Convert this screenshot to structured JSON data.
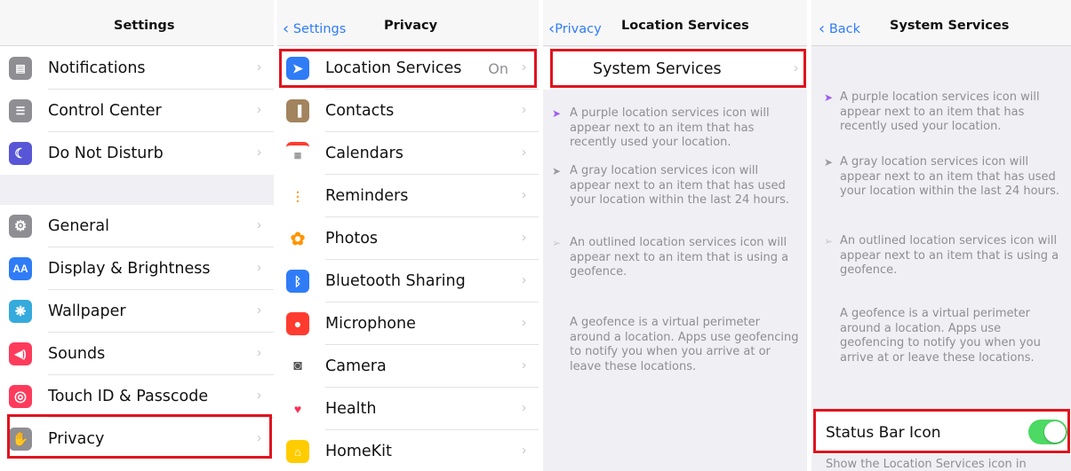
{
  "settings_panel": {
    "title": "Settings",
    "group1": [
      {
        "label": "Notifications",
        "icon": "notifications-icon",
        "color": "#8e8e93"
      },
      {
        "label": "Control Center",
        "icon": "control-center-icon",
        "color": "#8e8e93"
      },
      {
        "label": "Do Not Disturb",
        "icon": "moon-icon",
        "color": "#5856d6"
      }
    ],
    "group2": [
      {
        "label": "General",
        "icon": "gear-icon",
        "color": "#8e8e93"
      },
      {
        "label": "Display & Brightness",
        "icon": "display-brightness-icon",
        "color": "#2f7cf6",
        "glyph": "AA"
      },
      {
        "label": "Wallpaper",
        "icon": "wallpaper-icon",
        "color": "#35aadc"
      },
      {
        "label": "Sounds",
        "icon": "speaker-icon",
        "color": "#ff3b5c"
      },
      {
        "label": "Touch ID & Passcode",
        "icon": "fingerprint-icon",
        "color": "#ff3b5c"
      },
      {
        "label": "Privacy",
        "icon": "hand-icon",
        "color": "#8e8e93"
      }
    ]
  },
  "privacy_panel": {
    "back_label": "Settings",
    "title": "Privacy",
    "items": [
      {
        "label": "Location Services",
        "value": "On",
        "icon": "location-arrow-icon",
        "color": "#2f7cf6"
      },
      {
        "label": "Contacts",
        "icon": "contacts-icon",
        "color": "#a2845e"
      },
      {
        "label": "Calendars",
        "icon": "calendar-icon",
        "color": "#ffffff"
      },
      {
        "label": "Reminders",
        "icon": "reminders-icon",
        "color": "#ffffff"
      },
      {
        "label": "Photos",
        "icon": "photos-icon",
        "color": "#ff9500"
      },
      {
        "label": "Bluetooth Sharing",
        "icon": "bluetooth-icon",
        "color": "#2f7cf6"
      },
      {
        "label": "Microphone",
        "icon": "microphone-icon",
        "color": "#ff3b30"
      },
      {
        "label": "Camera",
        "icon": "camera-icon",
        "color": "#8e8e93"
      },
      {
        "label": "Health",
        "icon": "heart-icon",
        "color": "#ffffff"
      },
      {
        "label": "HomeKit",
        "icon": "homekit-icon",
        "color": "#ffcc00"
      }
    ]
  },
  "location_panel": {
    "back_label": "Privacy",
    "title": "Location Services",
    "row_label": "System Services",
    "notes": [
      "A purple location services icon will appear next to an item that has recently used your location.",
      "A gray location services icon will appear next to an item that has used your location within the last 24 hours.",
      "An outlined location services icon will appear next to an item that is using a geofence."
    ],
    "geofence_note": "A geofence is a virtual perimeter around a location. Apps use geofencing to notify you when you arrive at or leave these locations."
  },
  "system_panel": {
    "back_label": "Back",
    "title": "System Services",
    "notes": [
      "A purple location services icon will appear next to an item that has recently used your location.",
      "A gray location services icon will appear next to an item that has used your location within the last 24 hours.",
      "An outlined location services icon will appear next to an item that is using a geofence."
    ],
    "geofence_note": "A geofence is a virtual perimeter around a location. Apps use geofencing to notify you when you arrive at or leave these locations.",
    "status_bar_label": "Status Bar Icon",
    "status_bar_on": true,
    "truncated_footer": "Show the Location Services icon in"
  },
  "colors": {
    "highlight": "#e0141e",
    "accent": "#2f7cf6",
    "toggle_on": "#4cd964",
    "purple_arrow": "#a05cf0",
    "gray_arrow": "#9a9aa0"
  }
}
